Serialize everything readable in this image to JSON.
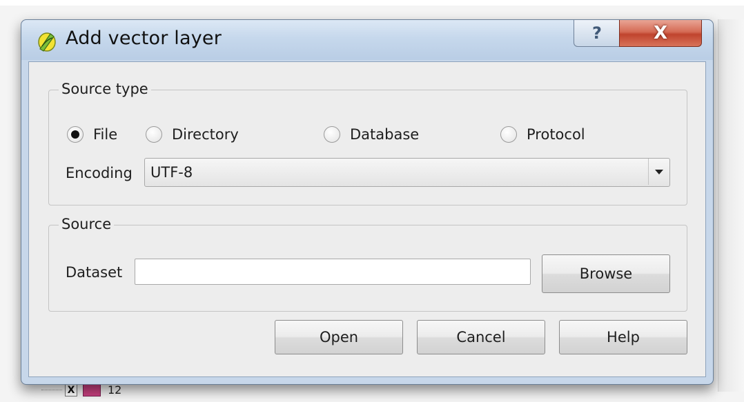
{
  "window": {
    "title": "Add vector layer",
    "help_glyph": "?",
    "close_glyph": "X"
  },
  "source_type": {
    "title": "Source type",
    "options": [
      {
        "label": "File",
        "checked": true
      },
      {
        "label": "Directory",
        "checked": false
      },
      {
        "label": "Database",
        "checked": false
      },
      {
        "label": "Protocol",
        "checked": false
      }
    ],
    "encoding_label": "Encoding",
    "encoding_value": "UTF-8"
  },
  "source": {
    "title": "Source",
    "dataset_label": "Dataset",
    "dataset_value": "",
    "browse_label": "Browse"
  },
  "buttons": {
    "open": "Open",
    "cancel": "Cancel",
    "help": "Help"
  },
  "background": {
    "layer_checkbox_glyph": "X",
    "layer_label": "12",
    "layer_color": "#c8407f"
  },
  "icons": {
    "app": "qgis-icon",
    "help": "question-icon",
    "close": "close-icon",
    "dropdown": "chevron-down-icon"
  }
}
